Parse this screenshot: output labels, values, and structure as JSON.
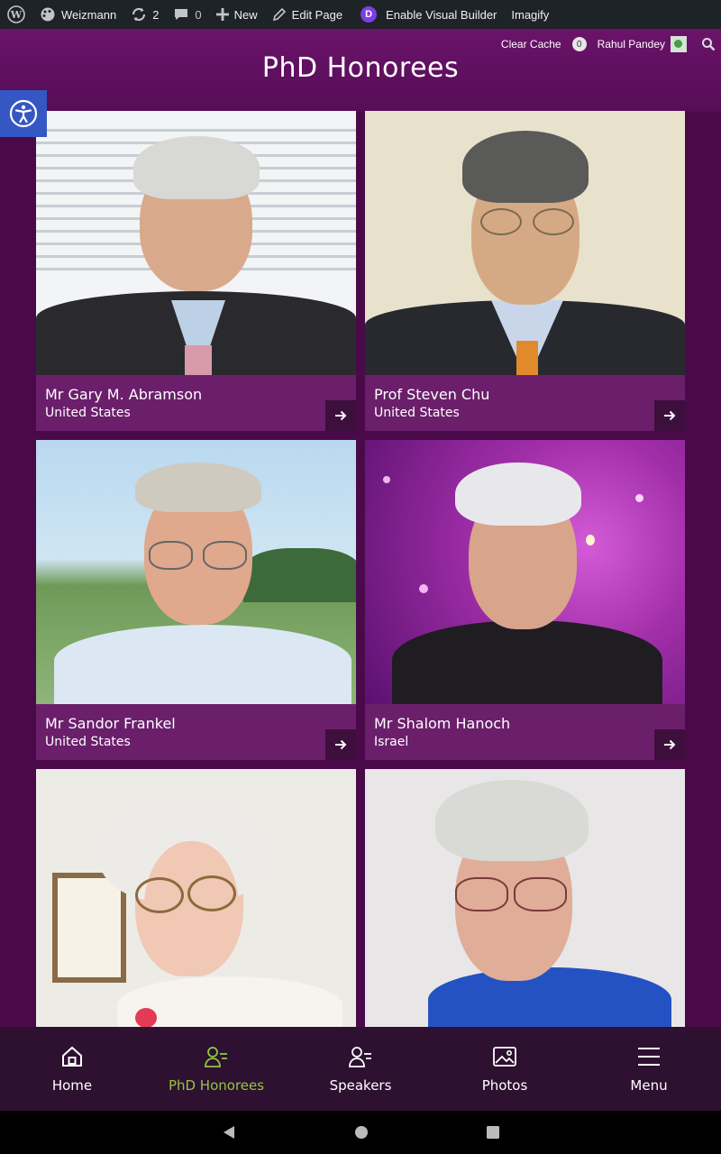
{
  "adminbar": {
    "site": "Weizmann",
    "updates": "2",
    "comments": "0",
    "new": "New",
    "edit": "Edit Page",
    "divi_letter": "D",
    "visual_builder": "Enable Visual Builder",
    "imagify": "Imagify"
  },
  "header": {
    "clear_cache": "Clear Cache",
    "cache_count": "0",
    "user": "Rahul Pandey",
    "title": "PhD Honorees"
  },
  "honorees": [
    {
      "name": "Mr Gary M. Abramson",
      "country": "United States"
    },
    {
      "name": "Prof Steven Chu",
      "country": "United States"
    },
    {
      "name": "Mr Sandor Frankel",
      "country": "United States"
    },
    {
      "name": "Mr Shalom Hanoch",
      "country": "Israel"
    },
    {
      "name": "",
      "country": ""
    },
    {
      "name": "",
      "country": ""
    }
  ],
  "nav": {
    "home": "Home",
    "honorees": "PhD Honorees",
    "speakers": "Speakers",
    "photos": "Photos",
    "menu": "Menu"
  },
  "colors": {
    "header": "#6a136a",
    "card_info": "#6b1f6b",
    "nav_bg": "#2e1030",
    "active": "#8fc740",
    "accessibility": "#3557c4"
  },
  "icons": [
    "wordpress-icon",
    "palette-icon",
    "refresh-icon",
    "comment-icon",
    "plus-icon",
    "pencil-icon",
    "search-icon",
    "accessibility-icon",
    "arrow-right-icon",
    "home-icon",
    "person-list-icon",
    "photos-icon",
    "hamburger-icon",
    "back-icon",
    "home-circle-icon",
    "recents-icon"
  ]
}
